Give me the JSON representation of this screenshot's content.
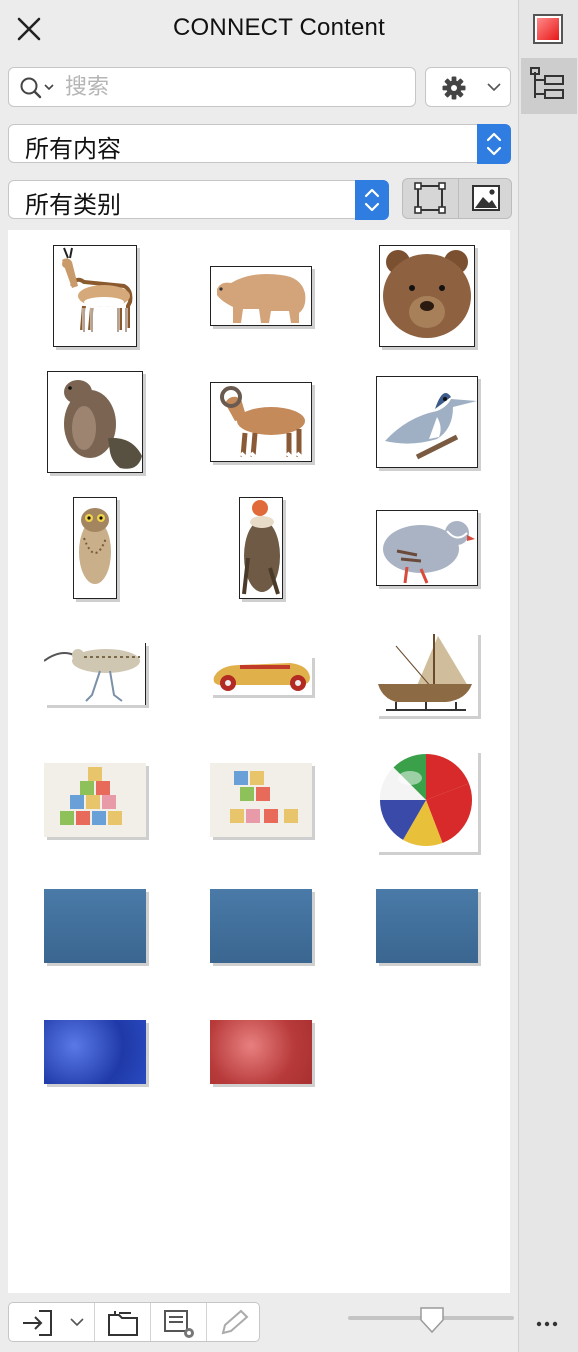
{
  "panel": {
    "title": "CONNECT Content",
    "search_placeholder": "搜索",
    "filter_content": "所有内容",
    "filter_category": "所有类别"
  },
  "icons": {
    "close": "close-icon",
    "search": "search-icon",
    "settings": "gear-icon",
    "view_frame": "frame-view-icon",
    "view_image": "image-view-icon",
    "import": "import-icon",
    "browse": "folder-browse-icon",
    "manage": "tray-settings-icon",
    "edit": "pencil-icon",
    "color": "color-swatch-icon",
    "tree": "tree-view-icon",
    "more": "more-icon"
  },
  "zoom": {
    "value": 0.5
  },
  "thumbnails": [
    {
      "id": "antelope"
    },
    {
      "id": "bear"
    },
    {
      "id": "bear-head"
    },
    {
      "id": "beaver"
    },
    {
      "id": "ram"
    },
    {
      "id": "kingfisher"
    },
    {
      "id": "owl"
    },
    {
      "id": "vulture"
    },
    {
      "id": "partridge"
    },
    {
      "id": "curlew"
    },
    {
      "id": "race-car"
    },
    {
      "id": "sailboat"
    },
    {
      "id": "blocks-1"
    },
    {
      "id": "blocks-2"
    },
    {
      "id": "beach-ball"
    },
    {
      "id": "blue-texture-1"
    },
    {
      "id": "blue-texture-2"
    },
    {
      "id": "blue-texture-3"
    },
    {
      "id": "blue-marble"
    },
    {
      "id": "red-marble"
    }
  ]
}
